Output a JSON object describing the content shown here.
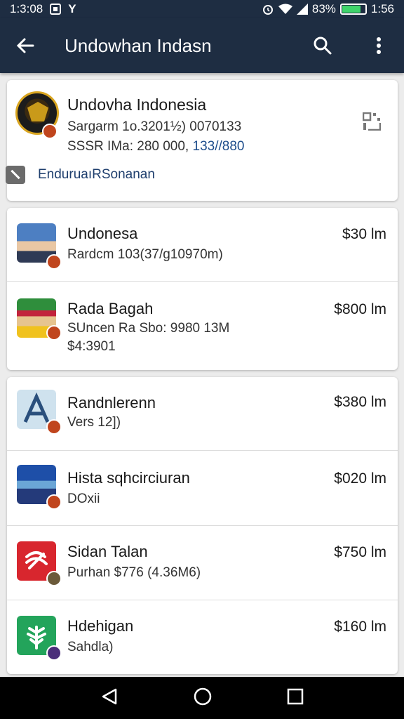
{
  "status": {
    "time": "1:3:08",
    "notif": "Y",
    "battery": "83%",
    "battery_level": 0.83,
    "clock": "1:56"
  },
  "appbar": {
    "title": "Undowhan Indasn"
  },
  "profile": {
    "name": "Undovha Indonesia",
    "line1": "Sargarm 1o.3201½) 0070133",
    "line2_prefix": "SSSR IMa: 280 000,",
    "line2_accent": "133//880",
    "link": "EnduruaıRSonanan"
  },
  "group1": [
    {
      "title": "Undonesa",
      "sub": "Rardcm 103(37/g10970m)",
      "price": "$30 lm",
      "thumb": "person-photo"
    },
    {
      "title": "Rada Bagah",
      "sub": "SUncen Ra Sbo: 9980 13M",
      "sub2": "$4:3901",
      "price": "$800 lm",
      "thumb": "person-photo"
    }
  ],
  "group2": [
    {
      "title": "Randnlerenn",
      "sub": "Vers 12])",
      "price": "$380 lm",
      "thumb": "app-icon"
    },
    {
      "title": "Hista sqhcirciuran",
      "sub": "DOxii",
      "price": "$020 lm",
      "thumb": "landscape-image"
    },
    {
      "title": "Sidan Talan",
      "sub": "Purhan $776 (4.36M6)",
      "price": "$750 lm",
      "thumb": "app-icon"
    },
    {
      "title": "Hdehigan",
      "sub": "Sahdla)",
      "price": "$160 lm",
      "thumb": "app-icon"
    }
  ],
  "colors": {
    "appbar": "#1e2d42",
    "accent": "#1f4e8c",
    "badge": "#c0451d"
  }
}
